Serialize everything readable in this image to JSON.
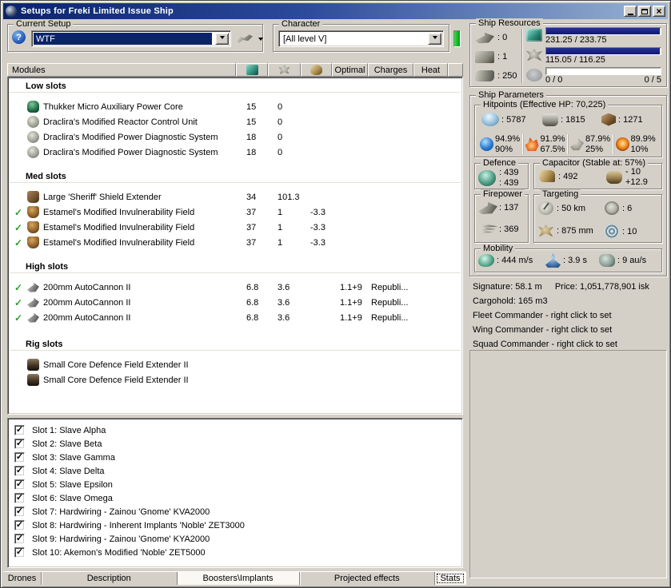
{
  "window": {
    "title": "Setups for Freki Limited Issue Ship"
  },
  "setup_group": {
    "label": "Current Setup",
    "value": "WTF"
  },
  "character_group": {
    "label": "Character",
    "value": "[All level V]"
  },
  "modules": {
    "header": {
      "name": "Modules",
      "optimal": "Optimal",
      "charges": "Charges",
      "heat": "Heat"
    },
    "sections": [
      {
        "label": "Low slots",
        "rows": [
          {
            "checked": false,
            "name": "Thukker Micro Auxiliary Power Core",
            "cpu": "15",
            "pg": "0",
            "cap": "",
            "optimal": "",
            "charges": "",
            "heat": ""
          },
          {
            "checked": false,
            "name": "Draclira's Modified Reactor Control Unit",
            "cpu": "15",
            "pg": "0",
            "cap": "",
            "optimal": "",
            "charges": "",
            "heat": ""
          },
          {
            "checked": false,
            "name": "Draclira's Modified Power Diagnostic System",
            "cpu": "18",
            "pg": "0",
            "cap": "",
            "optimal": "",
            "charges": "",
            "heat": ""
          },
          {
            "checked": false,
            "name": "Draclira's Modified Power Diagnostic System",
            "cpu": "18",
            "pg": "0",
            "cap": "",
            "optimal": "",
            "charges": "",
            "heat": ""
          }
        ]
      },
      {
        "label": "Med slots",
        "rows": [
          {
            "checked": false,
            "name": "Large 'Sheriff' Shield Extender",
            "cpu": "34",
            "pg": "101.3",
            "cap": "",
            "optimal": "",
            "charges": "",
            "heat": ""
          },
          {
            "checked": true,
            "name": "Estamel's Modified Invulnerability Field",
            "cpu": "37",
            "pg": "1",
            "cap": "-3.3",
            "optimal": "",
            "charges": "",
            "heat": ""
          },
          {
            "checked": true,
            "name": "Estamel's Modified Invulnerability Field",
            "cpu": "37",
            "pg": "1",
            "cap": "-3.3",
            "optimal": "",
            "charges": "",
            "heat": ""
          },
          {
            "checked": true,
            "name": "Estamel's Modified Invulnerability Field",
            "cpu": "37",
            "pg": "1",
            "cap": "-3.3",
            "optimal": "",
            "charges": "",
            "heat": ""
          }
        ]
      },
      {
        "label": "High slots",
        "rows": [
          {
            "checked": true,
            "name": "200mm AutoCannon II",
            "cpu": "6.8",
            "pg": "3.6",
            "cap": "",
            "optimal": "1.1+9",
            "charges": "Republi...",
            "heat": ""
          },
          {
            "checked": true,
            "name": "200mm AutoCannon II",
            "cpu": "6.8",
            "pg": "3.6",
            "cap": "",
            "optimal": "1.1+9",
            "charges": "Republi...",
            "heat": ""
          },
          {
            "checked": true,
            "name": "200mm AutoCannon II",
            "cpu": "6.8",
            "pg": "3.6",
            "cap": "",
            "optimal": "1.1+9",
            "charges": "Republi...",
            "heat": ""
          }
        ]
      },
      {
        "label": "Rig slots",
        "rows": [
          {
            "checked": false,
            "name": "Small Core Defence Field Extender II",
            "cpu": "",
            "pg": "",
            "cap": "",
            "optimal": "",
            "charges": "",
            "heat": ""
          },
          {
            "checked": false,
            "name": "Small Core Defence Field Extender II",
            "cpu": "",
            "pg": "",
            "cap": "",
            "optimal": "",
            "charges": "",
            "heat": ""
          }
        ]
      }
    ]
  },
  "implants": {
    "items": [
      {
        "checked": true,
        "label": "Slot 1: Slave Alpha"
      },
      {
        "checked": true,
        "label": "Slot 2: Slave Beta"
      },
      {
        "checked": true,
        "label": "Slot 3: Slave Gamma"
      },
      {
        "checked": true,
        "label": "Slot 4: Slave Delta"
      },
      {
        "checked": true,
        "label": "Slot 5: Slave Epsilon"
      },
      {
        "checked": true,
        "label": "Slot 6: Slave Omega"
      },
      {
        "checked": true,
        "label": "Slot 7: Hardwiring - Zainou 'Gnome' KVA2000"
      },
      {
        "checked": true,
        "label": "Slot 8: Hardwiring - Inherent Implants 'Noble' ZET3000"
      },
      {
        "checked": true,
        "label": "Slot 9: Hardwiring - Zainou 'Gnome' KYA2000"
      },
      {
        "checked": true,
        "label": "Slot 10: Akemon's Modified 'Noble' ZET5000"
      }
    ]
  },
  "tabs": [
    {
      "label": "Drones",
      "selected": false
    },
    {
      "label": "Description",
      "selected": false
    },
    {
      "label": "Boosters\\Implants",
      "selected": true
    },
    {
      "label": "Projected effects",
      "selected": false
    },
    {
      "label": "Stats",
      "selected": true
    }
  ],
  "ship_resources": {
    "label": "Ship Resources",
    "turrets": ": 0",
    "launchers": ": 1",
    "calibration": ": 250",
    "cpu_bar": {
      "text": "231.25 / 233.75",
      "pct": 99
    },
    "pg_bar": {
      "text": "115.05 / 116.25",
      "pct": 99
    },
    "drone_bar": {
      "used": "0 / 0",
      "bandwidth": "0 / 5",
      "pct": 0
    }
  },
  "ship_parameters": {
    "label": "Ship Parameters",
    "hitpoints": {
      "label": "Hitpoints (Effective HP: 70,225)",
      "shield": ": 5787",
      "armor": ": 1815",
      "structure": ": 1271",
      "resists": [
        {
          "top": "94.9%",
          "bottom": "90%"
        },
        {
          "top": "91.9%",
          "bottom": "67.5%"
        },
        {
          "top": "87.9%",
          "bottom": "25%"
        },
        {
          "top": "89.9%",
          "bottom": "10%"
        }
      ]
    },
    "defence": {
      "label": "Defence",
      "value1": ": 439",
      "value2": ": 439"
    },
    "capacitor": {
      "label": "Capacitor (Stable at: 57%)",
      "amount": ": 492",
      "drain": "- 10",
      "recharge": "+12.9"
    },
    "firepower": {
      "label": "Firepower",
      "dps": ": 137",
      "volley": ": 369"
    },
    "targeting": {
      "label": "Targeting",
      "range": ": 50 km",
      "max_targets": ": 6",
      "scan_resolution": ": 875 mm",
      "sensor_strength": ": 10"
    },
    "mobility": {
      "label": "Mobility",
      "max_velocity": ": 444 m/s",
      "align_time": ": 3.9 s",
      "warp_speed": ": 9 au/s"
    }
  },
  "info": {
    "signature": "Signature: 58.1 m",
    "price": "Price: 1,051,778,901 isk",
    "cargohold": "Cargohold: 165 m3",
    "fleet_commander": "Fleet Commander - right click to set",
    "wing_commander": "Wing Commander - right click to set",
    "squad_commander": "Squad Commander - right click to set"
  }
}
